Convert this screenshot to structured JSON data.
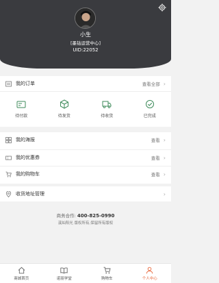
{
  "header": {
    "user_name": "小生",
    "user_role": "[墨钴运营中心]",
    "uid": "UID:22052",
    "settings_icon": "gear-icon"
  },
  "orders": {
    "title": "我的订单",
    "more": "查看全部",
    "types": [
      {
        "label": "待付款",
        "icon": "card-icon"
      },
      {
        "label": "待发货",
        "icon": "box-icon"
      },
      {
        "label": "待收货",
        "icon": "truck-icon"
      },
      {
        "label": "已完成",
        "icon": "check-circle-icon"
      }
    ]
  },
  "list": [
    {
      "label": "我的海报",
      "more": "查看",
      "icon": "poster-icon"
    },
    {
      "label": "我的优惠券",
      "more": "查看",
      "icon": "coupon-icon"
    },
    {
      "label": "我的购物车",
      "more": "查看",
      "icon": "cart-icon"
    }
  ],
  "address": {
    "label": "收货地址管理",
    "icon": "location-icon"
  },
  "footer": {
    "business_label": "商务合作:",
    "phone": "400-825-0990",
    "copyright": "溪灿阳光 版权所有,保留所有版权"
  },
  "tabbar": [
    {
      "label": "商城首页",
      "icon": "home-icon",
      "active": false
    },
    {
      "label": "诺丽学堂",
      "icon": "book-icon",
      "active": false
    },
    {
      "label": "购物车",
      "icon": "cart-icon",
      "active": false
    },
    {
      "label": "个人中心",
      "icon": "person-icon",
      "active": true
    }
  ],
  "colors": {
    "header_bg": "#3a3b3f",
    "accent": "#e8663a",
    "order_icon": "#3d8a5a"
  }
}
